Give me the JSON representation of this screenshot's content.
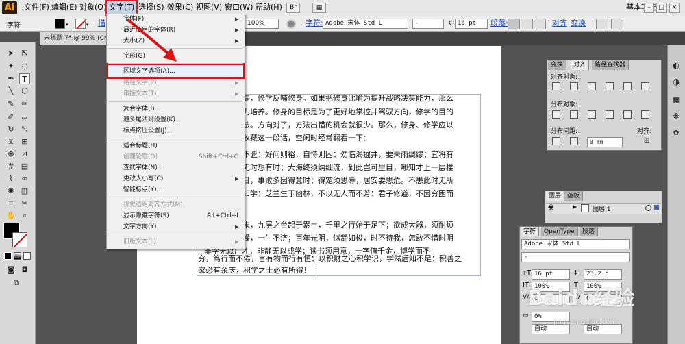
{
  "app": {
    "logo": "Ai",
    "workspace": "基本功能"
  },
  "menubar": {
    "items": [
      "文件(F)",
      "编辑(E)",
      "对象(O)",
      "文字(T)",
      "选择(S)",
      "效果(C)",
      "视图(V)",
      "窗口(W)",
      "帮助(H)"
    ]
  },
  "control_bar": {
    "label": "字符",
    "stroke_prefix": "描",
    "opacity": "100%",
    "font_link": "字符:",
    "font_value": "Adobe 宋体 Std L",
    "style_value": "-",
    "size_value": "16 pt",
    "para_link": "段落:",
    "align_link": "对齐",
    "transform_link": "变换"
  },
  "document": {
    "tab_title": "未标题-7* @ 99% (CM"
  },
  "type_menu": {
    "items": [
      {
        "label": "字体(F)",
        "shortcut": "",
        "arrow": true,
        "disabled": false
      },
      {
        "label": "最近使用的字体(R)",
        "shortcut": "",
        "arrow": true,
        "disabled": false
      },
      {
        "label": "大小(Z)",
        "shortcut": "",
        "arrow": true,
        "disabled": false
      },
      {
        "label": "字形(G)",
        "shortcut": "",
        "arrow": false,
        "disabled": false
      },
      {
        "label": "区域文字选项(A)...",
        "shortcut": "",
        "arrow": false,
        "disabled": false,
        "highlighted": true
      },
      {
        "label": "路径文字(P)",
        "shortcut": "",
        "arrow": true,
        "disabled": true
      },
      {
        "label": "串接文本(T)",
        "shortcut": "",
        "arrow": true,
        "disabled": true
      },
      {
        "label": "复合字体(I)...",
        "shortcut": "",
        "arrow": false,
        "disabled": false
      },
      {
        "label": "避头尾法则设置(K)...",
        "shortcut": "",
        "arrow": false,
        "disabled": false
      },
      {
        "label": "标点挤压设置(J)...",
        "shortcut": "",
        "arrow": false,
        "disabled": false
      },
      {
        "label": "适合标题(H)",
        "shortcut": "",
        "arrow": false,
        "disabled": false
      },
      {
        "label": "创建轮廓(O)",
        "shortcut": "Shift+Ctrl+O",
        "arrow": false,
        "disabled": true
      },
      {
        "label": "查找字体(N)...",
        "shortcut": "",
        "arrow": false,
        "disabled": false
      },
      {
        "label": "更改大小写(C)",
        "shortcut": "",
        "arrow": true,
        "disabled": false
      },
      {
        "label": "智能标点(Y)...",
        "shortcut": "",
        "arrow": false,
        "disabled": false
      },
      {
        "label": "视觉边距对齐方式(M)",
        "shortcut": "",
        "arrow": false,
        "disabled": true
      },
      {
        "label": "显示隐藏字符(S)",
        "shortcut": "Alt+Ctrl+I",
        "arrow": false,
        "disabled": false
      },
      {
        "label": "文字方向(Y)",
        "shortcut": "",
        "arrow": true,
        "disabled": false
      },
      {
        "label": "旧版文本(L)",
        "shortcut": "",
        "arrow": true,
        "disabled": true
      }
    ]
  },
  "text_lines": [
    "前提，修学反哺修身。如果把修身比喻为提升战略决策能力，那么",
    "能力培养。修身的目标是为了更好地掌控并驾驭方向，修学的目的",
    "方法。方向对了，方法出错的机会就很少。那么，修身、修学应以",
    "？收藏这一段话，空闲时经常翻看一下：",
    "",
    "则不匮；好问则裕，自恃则困；勿临渴掘井，要未雨绸缪；宜将有",
    "待无时想有时；大海终须纳细流，到此岂可里目，哪知才上一层楼",
    "昔日，事败多因得意时；得宠须思辱，居安要思危。不患此时无所",
    "不知学；芝兰生于幽林，不以无人而不芳；君子修道，不因穷困而",
    "",
    "",
    "毫末，九层之台起于累土，千里之行始于足下；欲成大器，须耐烦",
    "气躁，一生不济；百年光阴，似箭如梭，时不待我，怎敢不惜时阴",
    "非学无以广才，非静无以成学；读书须用意，一字值千金，博学而不",
    "穷，笃行而不倦，言有物而行有恒；以积财之心积学识，学然后知不足；积善之",
    "家必有余庆，积学之士必有所得！"
  ],
  "panels": {
    "align": {
      "tabs": [
        "变换",
        "对齐",
        "路径查找器"
      ],
      "align_objects": "对齐对象:",
      "distribute_objects": "分布对象:",
      "distribute_spacing": "分布间距:",
      "align_to": "对齐:",
      "spacing_value": "0 mm"
    },
    "layers": {
      "tabs": [
        "图层",
        "画板"
      ],
      "layer_name": "图层 1"
    },
    "character": {
      "tabs": [
        "字符",
        "OpenType",
        "段落"
      ],
      "font": "Adobe 宋体 Std L",
      "style": "-",
      "size": "16 pt",
      "leading": "23.2 p",
      "hscale": "100%",
      "vscale": "100%",
      "kern": "0",
      "tracking": "0",
      "shift": "0%",
      "auto1": "自动",
      "auto2": "自动"
    }
  },
  "watermark": {
    "brand": "Baidu经验",
    "url": "jingyan.baidu.com"
  }
}
